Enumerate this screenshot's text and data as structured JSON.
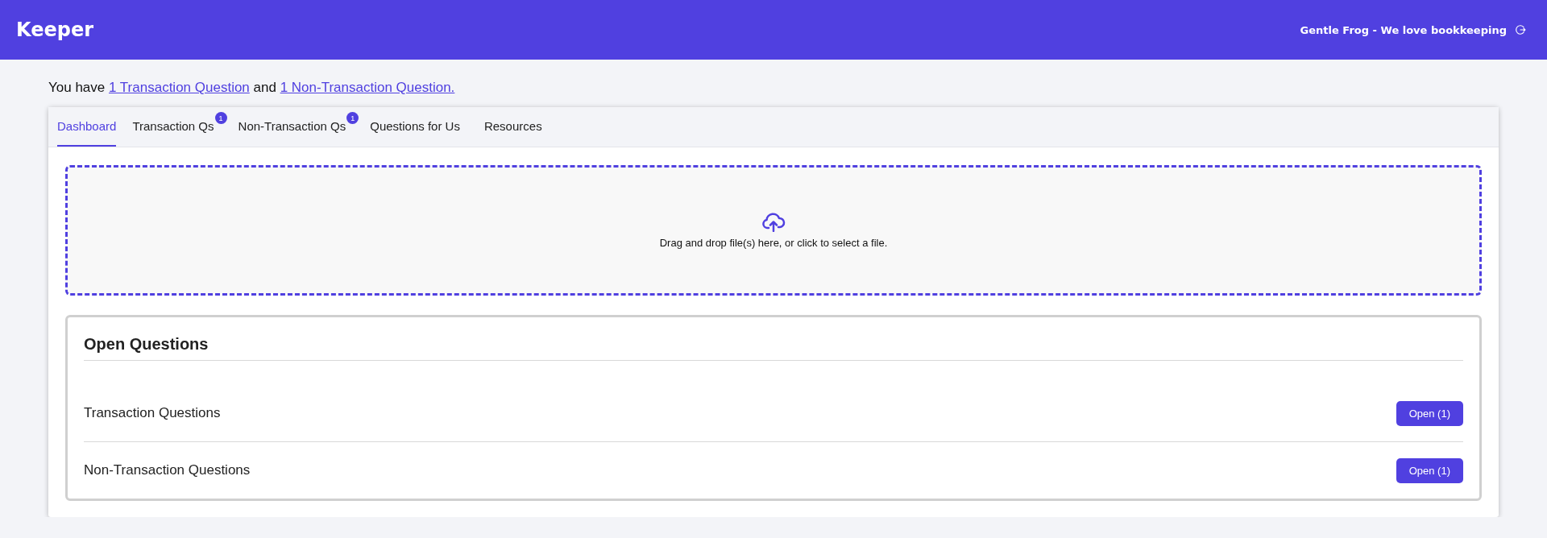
{
  "header": {
    "logo": "Keeper",
    "company": "Gentle Frog - We love bookkeeping"
  },
  "notice": [
    {
      "kind": "text",
      "text": "You have "
    },
    {
      "kind": "link",
      "text": "1 Transaction Question"
    },
    {
      "kind": "text",
      "text": " and "
    },
    {
      "kind": "link",
      "text": "1 Non-Transaction Question."
    }
  ],
  "tabs": [
    {
      "label": "Dashboard",
      "selected": true
    },
    {
      "label": "Transaction Qs",
      "selected": false,
      "badge": "1"
    },
    {
      "label": "Non-Transaction Qs",
      "selected": false,
      "badge": "1"
    },
    {
      "label": "Questions for Us",
      "selected": false
    },
    {
      "label": "Resources",
      "selected": false
    }
  ],
  "dropzone": {
    "text": "Drag and drop file(s) here, or click to select a file."
  },
  "open_questions": {
    "title": "Open Questions",
    "rows": [
      {
        "label": "Transaction Questions",
        "button": "Open (1)"
      },
      {
        "label": "Non-Transaction Questions",
        "button": "Open (1)"
      }
    ]
  }
}
